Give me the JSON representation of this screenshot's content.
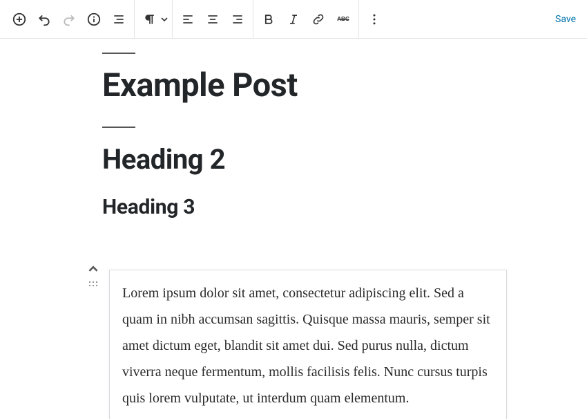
{
  "toolbar": {
    "save_label": "Save"
  },
  "content": {
    "title": "Example Post",
    "heading2": "Heading 2",
    "heading3": "Heading 3",
    "paragraph": "Lorem ipsum dolor sit amet, consectetur adipiscing elit. Sed a quam in nibh accumsan sagittis. Quisque massa mauris, semper sit amet dictum eget, blandit sit amet dui. Sed purus nulla, dictum viverra neque fermentum, mollis facilisis felis. Nunc cursus turpis quis lorem vulputate, ut interdum quam elementum."
  }
}
